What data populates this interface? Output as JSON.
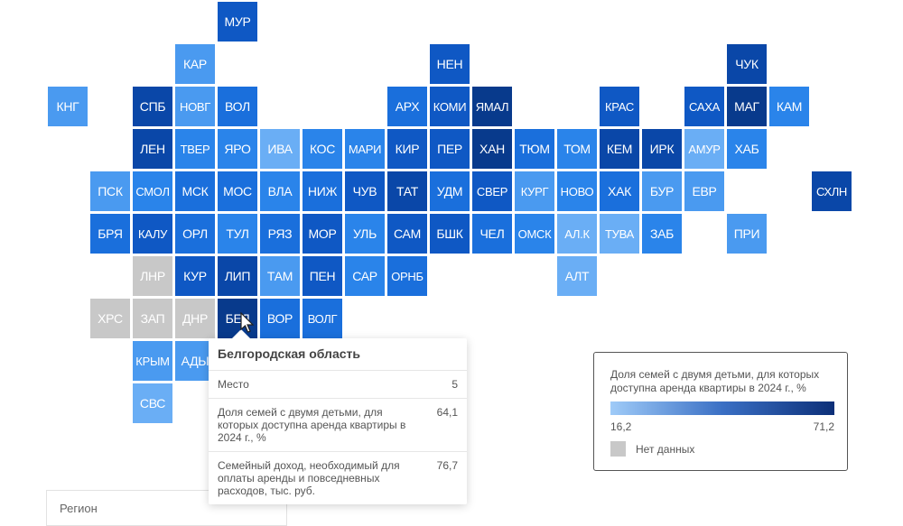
{
  "map": {
    "no_data_color": "#c8c8c8",
    "regions": [
      {
        "code": "МУР",
        "color": "#0f58c4"
      },
      {
        "code": "КАР",
        "color": "#4a9af0"
      },
      {
        "code": "НЕН",
        "color": "#0f58c4"
      },
      {
        "code": "ЧУК",
        "color": "#0a47a8"
      },
      {
        "code": "КНГ",
        "color": "#4a9af0"
      },
      {
        "code": "СПБ",
        "color": "#0a47a8"
      },
      {
        "code": "НОВГ",
        "color": "#4a9af0"
      },
      {
        "code": "ВОЛ",
        "color": "#1a6fdc"
      },
      {
        "code": "АРХ",
        "color": "#1a6fdc"
      },
      {
        "code": "КОМИ",
        "color": "#0f58c4"
      },
      {
        "code": "ЯМАЛ",
        "color": "#083a8c"
      },
      {
        "code": "КРАС",
        "color": "#0f58c4"
      },
      {
        "code": "САХА",
        "color": "#0f58c4"
      },
      {
        "code": "МАГ",
        "color": "#083a8c"
      },
      {
        "code": "КАМ",
        "color": "#2a84ea"
      },
      {
        "code": "ЛЕН",
        "color": "#0a47a8"
      },
      {
        "code": "ТВЕР",
        "color": "#2a84ea"
      },
      {
        "code": "ЯРО",
        "color": "#2a84ea"
      },
      {
        "code": "ИВА",
        "color": "#6aaef5"
      },
      {
        "code": "КОС",
        "color": "#2a84ea"
      },
      {
        "code": "МАРИ",
        "color": "#2a84ea"
      },
      {
        "code": "КИР",
        "color": "#0f58c4"
      },
      {
        "code": "ПЕР",
        "color": "#0f58c4"
      },
      {
        "code": "ХАН",
        "color": "#083a8c"
      },
      {
        "code": "ТЮМ",
        "color": "#1a6fdc"
      },
      {
        "code": "ТОМ",
        "color": "#2a84ea"
      },
      {
        "code": "КЕМ",
        "color": "#0a47a8"
      },
      {
        "code": "ИРК",
        "color": "#0a47a8"
      },
      {
        "code": "АМУР",
        "color": "#6aaef5"
      },
      {
        "code": "ХАБ",
        "color": "#2a84ea"
      },
      {
        "code": "ПСК",
        "color": "#4a9af0"
      },
      {
        "code": "СМОЛ",
        "color": "#2a84ea"
      },
      {
        "code": "МСК",
        "color": "#1a6fdc"
      },
      {
        "code": "МОС",
        "color": "#1a6fdc"
      },
      {
        "code": "ВЛА",
        "color": "#2a84ea"
      },
      {
        "code": "НИЖ",
        "color": "#1a6fdc"
      },
      {
        "code": "ЧУВ",
        "color": "#0f58c4"
      },
      {
        "code": "ТАТ",
        "color": "#0a47a8"
      },
      {
        "code": "УДМ",
        "color": "#1a6fdc"
      },
      {
        "code": "СВЕР",
        "color": "#0f58c4"
      },
      {
        "code": "КУРГ",
        "color": "#4a9af0"
      },
      {
        "code": "НОВО",
        "color": "#2a84ea"
      },
      {
        "code": "ХАК",
        "color": "#1a6fdc"
      },
      {
        "code": "БУР",
        "color": "#4a9af0"
      },
      {
        "code": "ЕВР",
        "color": "#4a9af0"
      },
      {
        "code": "СХЛН",
        "color": "#0a47a8"
      },
      {
        "code": "БРЯ",
        "color": "#1a6fdc"
      },
      {
        "code": "КАЛУ",
        "color": "#0f58c4"
      },
      {
        "code": "ОРЛ",
        "color": "#1a6fdc"
      },
      {
        "code": "ТУЛ",
        "color": "#2a84ea"
      },
      {
        "code": "РЯЗ",
        "color": "#1a6fdc"
      },
      {
        "code": "МОР",
        "color": "#0f58c4"
      },
      {
        "code": "УЛЬ",
        "color": "#2a84ea"
      },
      {
        "code": "САМ",
        "color": "#0f58c4"
      },
      {
        "code": "БШК",
        "color": "#0f58c4"
      },
      {
        "code": "ЧЕЛ",
        "color": "#1a6fdc"
      },
      {
        "code": "ОМСК",
        "color": "#2a84ea"
      },
      {
        "code": "АЛ.К",
        "color": "#6aaef5"
      },
      {
        "code": "ТУВА",
        "color": "#6aaef5"
      },
      {
        "code": "ЗАБ",
        "color": "#2a84ea"
      },
      {
        "code": "ПРИ",
        "color": "#4a9af0"
      },
      {
        "code": "ЛНР",
        "color": "#c8c8c8"
      },
      {
        "code": "КУР",
        "color": "#0f58c4"
      },
      {
        "code": "ЛИП",
        "color": "#0a47a8"
      },
      {
        "code": "ТАМ",
        "color": "#4a9af0"
      },
      {
        "code": "ПЕН",
        "color": "#0f58c4"
      },
      {
        "code": "САР",
        "color": "#2a84ea"
      },
      {
        "code": "ОРНБ",
        "color": "#1a6fdc"
      },
      {
        "code": "АЛТ",
        "color": "#6aaef5"
      },
      {
        "code": "ХРС",
        "color": "#c8c8c8"
      },
      {
        "code": "ЗАП",
        "color": "#c8c8c8"
      },
      {
        "code": "ДНР",
        "color": "#c8c8c8"
      },
      {
        "code": "БЕЛ",
        "color": "#083a8c"
      },
      {
        "code": "ВОР",
        "color": "#1a6fdc"
      },
      {
        "code": "ВОЛГ",
        "color": "#1a6fdc"
      },
      {
        "code": "КРЫМ",
        "color": "#4a9af0"
      },
      {
        "code": "АДЫ",
        "color": "#4a9af0"
      },
      {
        "code": "СВС",
        "color": "#6aaef5"
      }
    ]
  },
  "tooltip": {
    "title": "Белгородская область",
    "rows": [
      {
        "label": "Место",
        "value": "5"
      },
      {
        "label": "Доля семей с двумя детьми, для которых доступна аренда квартиры в 2024 г., %",
        "value": "64,1"
      },
      {
        "label": "Семейный доход, необходимый для оплаты аренды и повседневных расходов, тыс. руб.",
        "value": "76,7"
      }
    ]
  },
  "legend": {
    "title": "Доля семей с двумя детьми, для которых доступна аренда квартиры в 2024 г., %",
    "min": "16,2",
    "max": "71,2",
    "gradient_colors": [
      "#9fcbf8",
      "#0c2f78"
    ],
    "no_data_label": "Нет данных"
  },
  "region_select": {
    "label": "Регион"
  }
}
